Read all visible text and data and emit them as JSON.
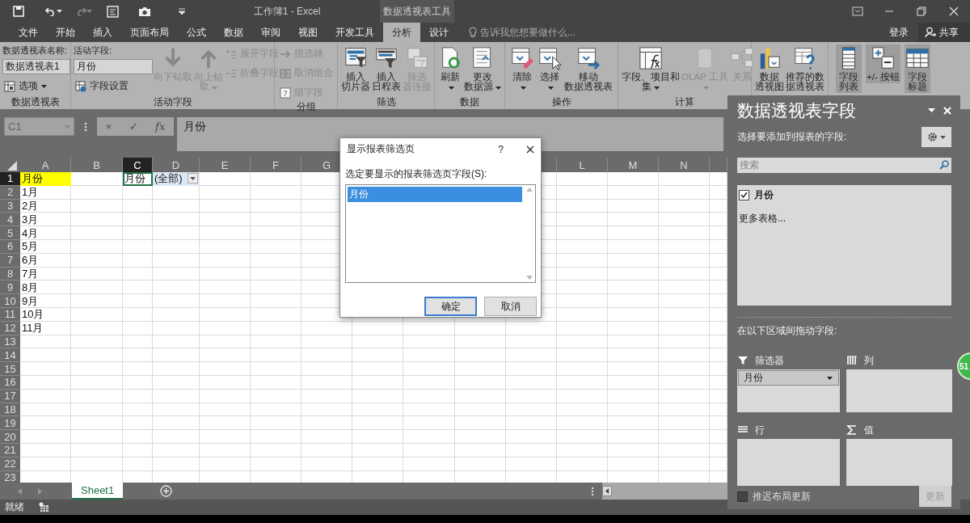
{
  "title_bar": {
    "title": "工作簿1 - Excel",
    "context_tab": "数据透视表工具"
  },
  "tabs": [
    {
      "label": "文件",
      "selected": false
    },
    {
      "label": "开始",
      "selected": false
    },
    {
      "label": "插入",
      "selected": false
    },
    {
      "label": "页面布局",
      "selected": false
    },
    {
      "label": "公式",
      "selected": false
    },
    {
      "label": "数据",
      "selected": false
    },
    {
      "label": "审阅",
      "selected": false
    },
    {
      "label": "视图",
      "selected": false
    },
    {
      "label": "开发工具",
      "selected": false
    },
    {
      "label": "分析",
      "selected": true
    },
    {
      "label": "设计",
      "selected": false
    }
  ],
  "tell_me": {
    "placeholder": "告诉我您想要做什么..."
  },
  "account": {
    "sign_in": "登录",
    "share": "共享"
  },
  "ribbon": [
    {
      "label": "数据透视表",
      "columns": [
        [
          {
            "kind": "caption",
            "text": "数据透视表名称:"
          },
          {
            "kind": "field",
            "value": "数据透视表1"
          },
          {
            "kind": "small",
            "text": "选项",
            "dropdown": true,
            "disabled": false
          }
        ]
      ]
    },
    {
      "label": "活动字段",
      "columns": [
        [
          {
            "kind": "caption",
            "text": "活动字段:"
          },
          {
            "kind": "field",
            "value": "月份"
          },
          {
            "kind": "small",
            "text": "字段设置",
            "dropdown": false,
            "disabled": false
          }
        ],
        [
          {
            "kind": "large",
            "text": "向下钻取",
            "dropdown": false,
            "disabled": true
          }
        ],
        [
          {
            "kind": "large",
            "text": "向上钻取",
            "dropdown": true,
            "disabled": true
          }
        ],
        [
          {
            "kind": "small",
            "text": "展开字段",
            "dropdown": false,
            "disabled": true
          },
          {
            "kind": "small",
            "text": "折叠字段",
            "dropdown": false,
            "disabled": true
          }
        ]
      ]
    },
    {
      "label": "分组",
      "columns": [
        [
          {
            "kind": "small",
            "text": "组选择",
            "dropdown": false,
            "disabled": true
          },
          {
            "kind": "small",
            "text": "取消组合",
            "dropdown": false,
            "disabled": true
          },
          {
            "kind": "small",
            "text": "组字段",
            "dropdown": false,
            "disabled": true
          }
        ]
      ]
    },
    {
      "label": "筛选",
      "columns": [
        [
          {
            "kind": "large",
            "text": "插入切片器",
            "dropdown": false,
            "disabled": false
          }
        ],
        [
          {
            "kind": "large",
            "text": "插入日程表",
            "dropdown": false,
            "disabled": false
          }
        ],
        [
          {
            "kind": "large",
            "text": "筛选器连接",
            "dropdown": false,
            "disabled": true
          }
        ]
      ]
    },
    {
      "label": "数据",
      "columns": [
        [
          {
            "kind": "large",
            "text": "刷新",
            "dropdown": true,
            "disabled": false
          }
        ],
        [
          {
            "kind": "large",
            "text": "更改数据源",
            "dropdown": true,
            "disabled": false
          }
        ]
      ]
    },
    {
      "label": "操作",
      "columns": [
        [
          {
            "kind": "large",
            "text": "清除",
            "dropdown": true,
            "disabled": false
          }
        ],
        [
          {
            "kind": "large",
            "text": "选择",
            "dropdown": true,
            "disabled": false
          }
        ],
        [
          {
            "kind": "large",
            "text": "移动数据透视表",
            "dropdown": false,
            "disabled": false
          }
        ]
      ]
    },
    {
      "label": "计算",
      "columns": [
        [
          {
            "kind": "large",
            "text": "字段、项目和集",
            "dropdown": true,
            "disabled": false
          }
        ],
        [
          {
            "kind": "large",
            "text": "OLAP 工具",
            "dropdown": true,
            "disabled": true
          }
        ],
        [
          {
            "kind": "large",
            "text": "关系",
            "dropdown": false,
            "disabled": true
          }
        ]
      ]
    },
    {
      "columns": [
        [
          {
            "kind": "large",
            "text": "数据透视图",
            "dropdown": false,
            "disabled": false
          }
        ],
        [
          {
            "kind": "large",
            "text": "推荐的数据透视表",
            "dropdown": false,
            "disabled": false
          }
        ]
      ]
    },
    {
      "columns": [
        [
          {
            "kind": "large",
            "text": "字段列表",
            "dropdown": false,
            "disabled": false,
            "on": true
          }
        ],
        [
          {
            "kind": "large",
            "text": "+/- 按钮",
            "dropdown": false,
            "disabled": false,
            "on": true
          }
        ],
        [
          {
            "kind": "large",
            "text": "字段标题",
            "dropdown": false,
            "disabled": false,
            "on": true
          }
        ]
      ]
    }
  ],
  "formula_bar": {
    "name_box": "C1",
    "buttons": [
      "×",
      "✓",
      "fx"
    ],
    "value": "月份"
  },
  "columns": [
    {
      "label": "A",
      "selected": false
    },
    {
      "label": "B",
      "selected": false
    },
    {
      "label": "C",
      "selected": true
    },
    {
      "label": "D",
      "selected": false
    },
    {
      "label": "E",
      "selected": false
    },
    {
      "label": "F",
      "selected": false
    },
    {
      "label": "G",
      "selected": false
    },
    {
      "label": "L",
      "selected": false
    },
    {
      "label": "M",
      "selected": false
    },
    {
      "label": "N",
      "selected": false
    }
  ],
  "rows": [
    {
      "number": "1",
      "selected": true,
      "column_a": {
        "text": "月份",
        "highlighted": true
      },
      "column_c": {
        "text": "月份",
        "active": true
      },
      "column_d": {
        "text": "(全部)",
        "dropdown": true
      }
    },
    {
      "number": "2",
      "selected": false,
      "column_a": {
        "text": "1月",
        "highlighted": false
      }
    },
    {
      "number": "3",
      "selected": false,
      "column_a": {
        "text": "2月",
        "highlighted": false
      }
    },
    {
      "number": "4",
      "selected": false,
      "column_a": {
        "text": "3月",
        "highlighted": false
      }
    },
    {
      "number": "5",
      "selected": false,
      "column_a": {
        "text": "4月",
        "highlighted": false
      }
    },
    {
      "number": "6",
      "selected": false,
      "column_a": {
        "text": "5月",
        "highlighted": false
      }
    },
    {
      "number": "7",
      "selected": false,
      "column_a": {
        "text": "6月",
        "highlighted": false
      }
    },
    {
      "number": "8",
      "selected": false,
      "column_a": {
        "text": "7月",
        "highlighted": false
      }
    },
    {
      "number": "9",
      "selected": false,
      "column_a": {
        "text": "8月",
        "highlighted": false
      }
    },
    {
      "number": "10",
      "selected": false,
      "column_a": {
        "text": "9月",
        "highlighted": false
      }
    },
    {
      "number": "11",
      "selected": false,
      "column_a": {
        "text": "10月",
        "highlighted": false
      }
    },
    {
      "number": "12",
      "selected": false,
      "column_a": {
        "text": "11月",
        "highlighted": false
      }
    },
    {
      "number": "13",
      "selected": false
    },
    {
      "number": "14",
      "selected": false
    },
    {
      "number": "15",
      "selected": false
    },
    {
      "number": "16",
      "selected": false
    },
    {
      "number": "17",
      "selected": false
    },
    {
      "number": "18",
      "selected": false
    },
    {
      "number": "19",
      "selected": false
    },
    {
      "number": "20",
      "selected": false
    },
    {
      "number": "21",
      "selected": false
    },
    {
      "number": "22",
      "selected": false
    },
    {
      "number": "23",
      "selected": false
    }
  ],
  "sheet_tabs": [
    {
      "label": "Sheet1",
      "selected": true
    }
  ],
  "status_bar": {
    "text": "就绪"
  },
  "field_pane": {
    "title": "数据透视表字段",
    "prompt": "选择要添加到报表的字段:",
    "search": {
      "placeholder": "搜索"
    },
    "fields": [
      {
        "label": "月份",
        "checked": true
      }
    ],
    "more_tables": "更多表格...",
    "areas_prompt": "在以下区域间拖动字段:",
    "areas": [
      {
        "label": "筛选器",
        "items": [
          "月份"
        ]
      },
      {
        "label": "列"
      },
      {
        "label": "行"
      },
      {
        "label": "值"
      }
    ],
    "defer_update": {
      "label": "推迟布局更新",
      "checked": false
    },
    "update_button": {
      "label": "更新",
      "disabled": true
    }
  },
  "dialog": {
    "title": "显示报表筛选页",
    "help": "?",
    "prompt": "选定要显示的报表筛选页字段(S):",
    "items": [
      {
        "label": "月份",
        "selected": true
      }
    ],
    "buttons": [
      {
        "label": "确定",
        "default": true
      },
      {
        "label": "取消",
        "default": false
      }
    ]
  },
  "badge": "51"
}
